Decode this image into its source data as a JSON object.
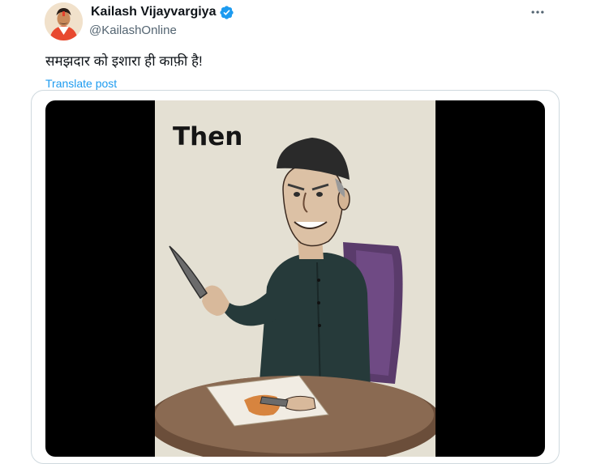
{
  "author": {
    "display_name": "Kailash Vijayvargiya",
    "handle": "@KailashOnline",
    "verified": true
  },
  "post": {
    "text": "समझदार को इशारा ही काफ़ी है!",
    "translate_label": "Translate post"
  },
  "media": {
    "caption": "Then"
  },
  "icons": {
    "verified": "verified-badge-icon",
    "more": "more-horizontal-icon"
  },
  "colors": {
    "accent": "#1d9bf0",
    "secondary_text": "#536471",
    "primary_text": "#0f1419",
    "media_background": "#000000",
    "illustration_background": "#e4e0d3"
  }
}
